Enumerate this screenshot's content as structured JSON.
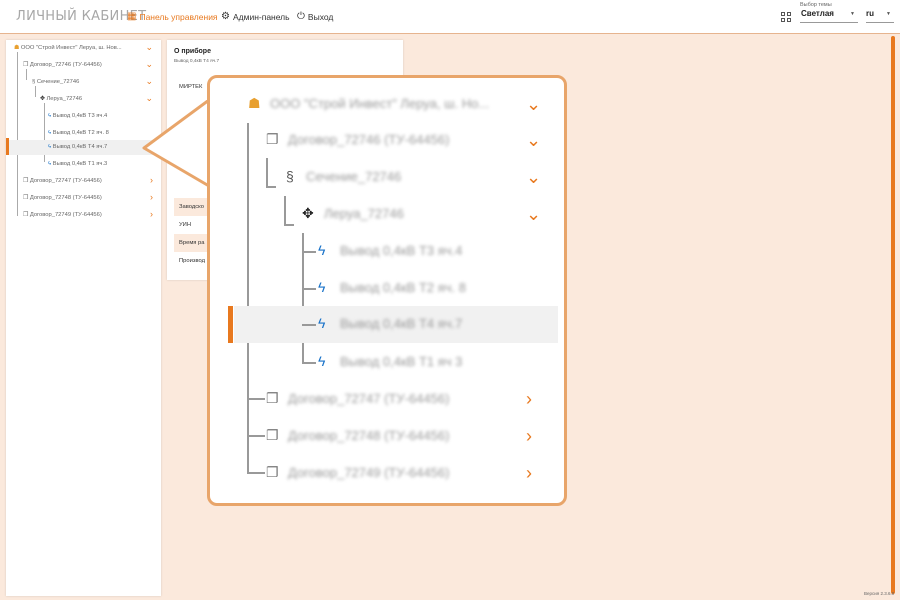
{
  "header": {
    "logo": "ЛИЧНЫЙ КАБИНЕТ",
    "nav": [
      {
        "label": "Панель управления",
        "active": true
      },
      {
        "label": "Админ-панель",
        "active": false
      },
      {
        "label": "Выход",
        "active": false
      }
    ],
    "theme_label": "Выбор темы",
    "theme_value": "Светлая",
    "lang_value": "ru"
  },
  "tree": {
    "items": [
      {
        "label": "ООО \"Строй Инвест\" Леруа, ш. Нов...",
        "icon": "org-icon",
        "level": 0,
        "expanded": true
      },
      {
        "label": "Договор_72746 (ТУ-64456)",
        "icon": "contract-icon",
        "level": 1,
        "expanded": true
      },
      {
        "label": "Сечение_72746",
        "icon": "section-icon",
        "level": 2,
        "expanded": true
      },
      {
        "label": "Леруа_72746",
        "icon": "object-icon",
        "level": 3,
        "expanded": true
      },
      {
        "label": "Вывод 0,4кВ Т3 яч.4",
        "icon": "feeder-icon",
        "level": 4
      },
      {
        "label": "Вывод 0,4кВ Т2 яч. 8",
        "icon": "feeder-icon",
        "level": 4
      },
      {
        "label": "Вывод 0,4кВ Т4 яч.7",
        "icon": "feeder-icon",
        "level": 4,
        "selected": true
      },
      {
        "label": "Вывод 0,4кВ Т1 яч.3",
        "icon": "feeder-icon",
        "level": 4
      },
      {
        "label": "Договор_72747 (ТУ-64456)",
        "icon": "contract-icon",
        "level": 1,
        "expanded": false
      },
      {
        "label": "Договор_72748 (ТУ-64456)",
        "icon": "contract-icon",
        "level": 1,
        "expanded": false
      },
      {
        "label": "Договор_72749 (ТУ-64456)",
        "icon": "contract-icon",
        "level": 1,
        "expanded": false
      }
    ]
  },
  "zoom_tree": {
    "items": [
      {
        "label": "ООО \"Строй Инвест\" Леруа, ш. Но..."
      },
      {
        "label": "Договор_72746 (ТУ-64456)"
      },
      {
        "label": "Сечение_72746"
      },
      {
        "label": "Леруа_72746"
      },
      {
        "label": "Вывод 0,4кВ Т3 яч.4"
      },
      {
        "label": "Вывод 0,4кВ Т2 яч. 8"
      },
      {
        "label": "Вывод 0,4кВ Т4 яч.7"
      },
      {
        "label": "Вывод 0,4кВ Т1 яч 3"
      },
      {
        "label": "Договор_72747 (ТУ-64456)"
      },
      {
        "label": "Договор_72748 (ТУ-64456)"
      },
      {
        "label": "Договор_72749 (ТУ-64456)"
      }
    ]
  },
  "info": {
    "title": "О приборе",
    "subtitle": "Вывод 0,4кВ Т4 яч.7",
    "rows": [
      "МИРТЕК",
      "Заводско",
      "УИН",
      "Время ра",
      "Производ"
    ]
  },
  "version": "Версия 2.3.6.0",
  "colors": {
    "accent": "#e8791f",
    "background": "#fbe9dc",
    "callout_border": "#e8a56a"
  }
}
